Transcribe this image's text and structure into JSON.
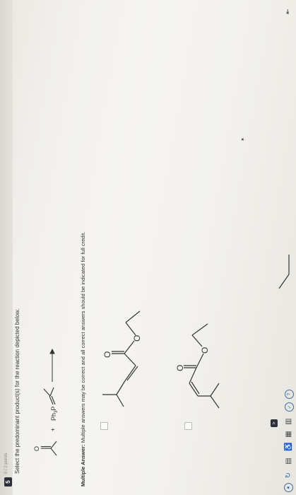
{
  "question": {
    "number": "5",
    "points": "0 / 2 points",
    "prompt": "Select the predominant product(s) for the reaction depicted below.",
    "reagent_label": "Ph3P",
    "plus_sign": "+",
    "hint_bold": "Multiple Answer:",
    "hint_text": " Multiple answers may be correct and all correct answers should be indicated for full credit."
  },
  "answers": [
    {
      "id": "a",
      "checked": false
    },
    {
      "id": "b",
      "checked": false
    }
  ],
  "atoms": {
    "oxygen": "O"
  },
  "toolbar": {
    "icons": [
      "circle-icon",
      "refresh-icon",
      "book-icon",
      "accessibility-icon",
      "calculator-icon",
      "table-icon",
      "check-icon",
      "help-icon"
    ]
  },
  "navigation": {
    "submit_label": ">",
    "collapse_label": "⇤"
  },
  "colors": {
    "badge": "#2a2f3a",
    "accent": "#3a6ea5"
  }
}
